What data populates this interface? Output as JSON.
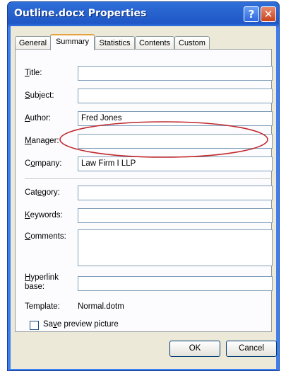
{
  "window": {
    "title": "Outline.docx Properties"
  },
  "titlebar": {
    "help_glyph": "?",
    "close_glyph": "✕"
  },
  "tabs": [
    {
      "label": "General"
    },
    {
      "label": "Summary",
      "active": true
    },
    {
      "label": "Statistics"
    },
    {
      "label": "Contents"
    },
    {
      "label": "Custom"
    }
  ],
  "fields": {
    "title": {
      "label_pre": "",
      "label_key": "T",
      "label_post": "itle:",
      "value": ""
    },
    "subject": {
      "label_pre": "",
      "label_key": "S",
      "label_post": "ubject:",
      "value": ""
    },
    "author": {
      "label_pre": "",
      "label_key": "A",
      "label_post": "uthor:",
      "value": "Fred Jones"
    },
    "manager": {
      "label_pre": "",
      "label_key": "M",
      "label_post": "anager:",
      "value": ""
    },
    "company": {
      "label_pre": "C",
      "label_key": "o",
      "label_post": "mpany:",
      "value": "Law Firm I LLP"
    },
    "category": {
      "label_pre": "Cat",
      "label_key": "e",
      "label_post": "gory:",
      "value": ""
    },
    "keywords": {
      "label_pre": "",
      "label_key": "K",
      "label_post": "eywords:",
      "value": ""
    },
    "comments": {
      "label_pre": "",
      "label_key": "C",
      "label_post": "omments:",
      "value": ""
    },
    "hyperlink": {
      "label_pre": "",
      "label_key": "H",
      "label_post": "yperlink",
      "label_line2": "base:",
      "value": ""
    }
  },
  "template": {
    "label": "Template:",
    "value": "Normal.dotm"
  },
  "save_preview": {
    "label_pre": "Sa",
    "label_key": "v",
    "label_post": "e preview picture",
    "checked": false
  },
  "buttons": {
    "ok": "OK",
    "cancel": "Cancel"
  },
  "colors": {
    "highlight_ellipse": "#c0282d",
    "title_bar": "#1f57c6"
  }
}
